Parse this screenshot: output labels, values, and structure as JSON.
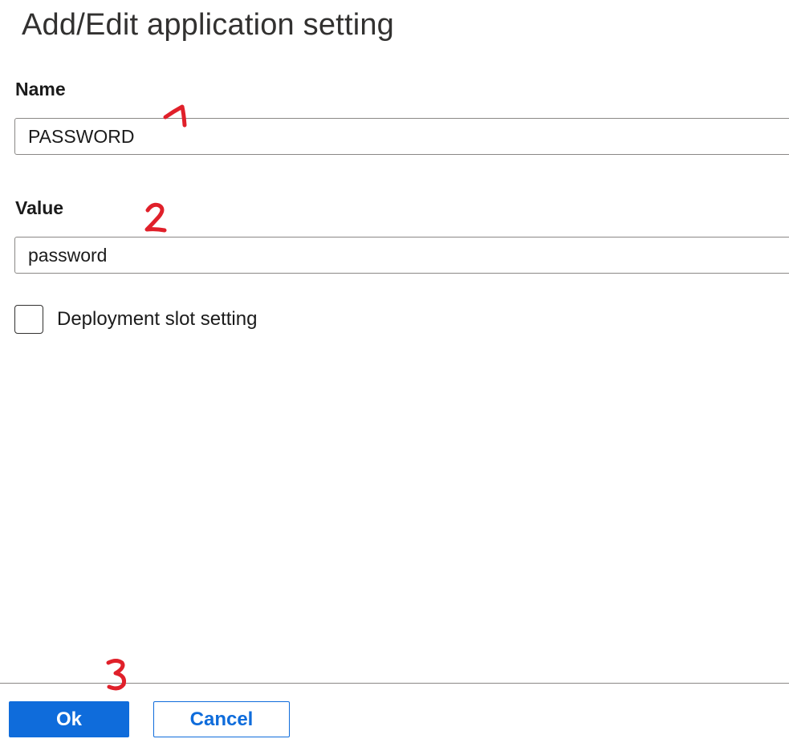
{
  "panel": {
    "title": "Add/Edit application setting"
  },
  "form": {
    "name_label": "Name",
    "name_value": "PASSWORD",
    "value_label": "Value",
    "value_value": "password",
    "slot_setting_label": "Deployment slot setting",
    "slot_setting_checked": false
  },
  "footer": {
    "ok_label": "Ok",
    "cancel_label": "Cancel"
  },
  "annotations": [
    "1",
    "2",
    "3"
  ],
  "colors": {
    "primary": "#0f6cdb",
    "annotation": "#e0202a",
    "border": "#8a8886"
  }
}
